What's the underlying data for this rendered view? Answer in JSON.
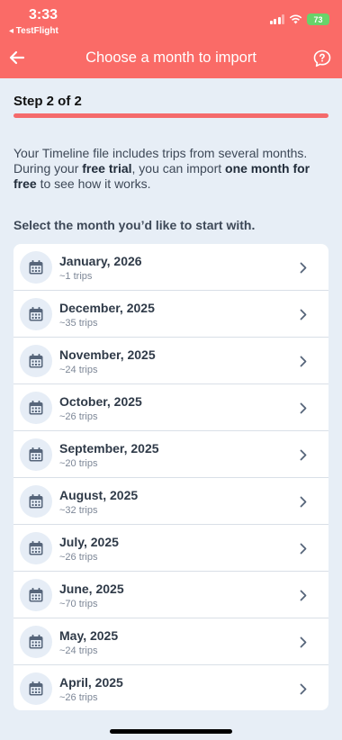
{
  "status_bar": {
    "time": "3:33",
    "back_app": "◂ TestFlight",
    "battery": "73"
  },
  "header": {
    "title": "Choose a month to import"
  },
  "step": {
    "label": "Step 2 of 2"
  },
  "intro": {
    "part1": "Your Timeline file includes trips from several months. During your ",
    "bold1": "free trial",
    "part2": ", you can import ",
    "bold2": "one month for free",
    "part3": " to see how it works."
  },
  "select_label": "Select the month you’d like to start with.",
  "months": [
    {
      "label": "January, 2026",
      "trips": "~1 trips"
    },
    {
      "label": "December, 2025",
      "trips": "~35 trips"
    },
    {
      "label": "November, 2025",
      "trips": "~24 trips"
    },
    {
      "label": "October, 2025",
      "trips": "~26 trips"
    },
    {
      "label": "September, 2025",
      "trips": "~20 trips"
    },
    {
      "label": "August, 2025",
      "trips": "~32 trips"
    },
    {
      "label": "July, 2025",
      "trips": "~26 trips"
    },
    {
      "label": "June, 2025",
      "trips": "~70 trips"
    },
    {
      "label": "May, 2025",
      "trips": "~24 trips"
    },
    {
      "label": "April, 2025",
      "trips": "~26 trips"
    }
  ],
  "colors": {
    "header": "#fa6b67",
    "background": "#e7eef6",
    "battery": "#69d36a"
  },
  "icons": [
    "arrow-left-icon",
    "help-chat-icon",
    "calendar-icon",
    "chevron-right-icon"
  ]
}
